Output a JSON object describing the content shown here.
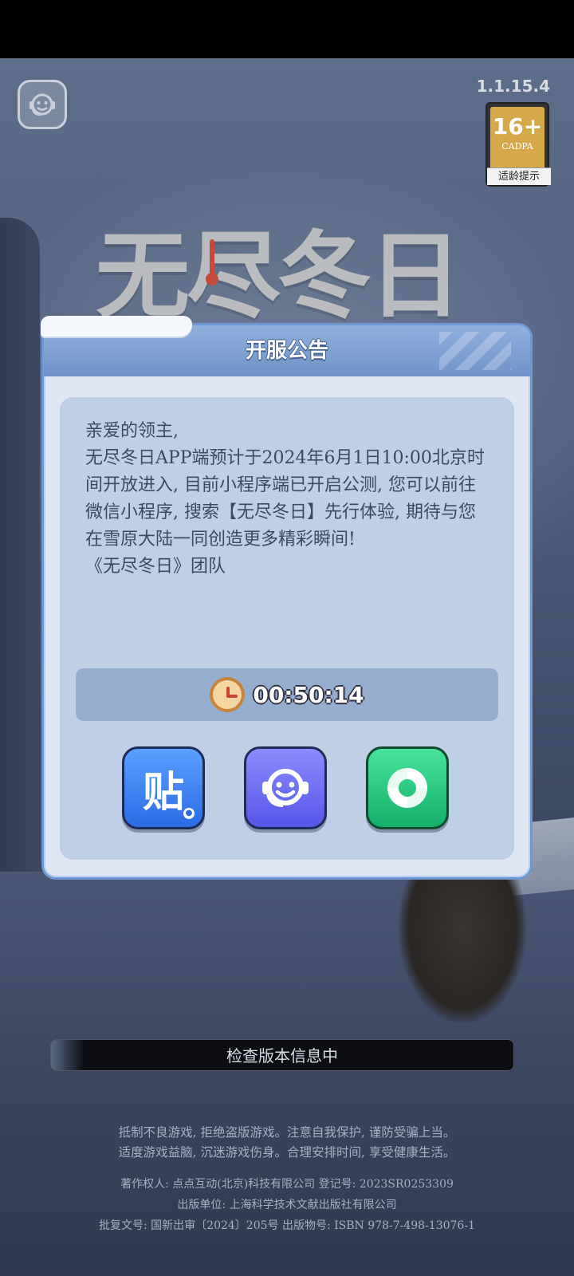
{
  "top": {
    "version": "1.1.15.4",
    "age_rating": {
      "number": "16+",
      "org": "CADPA",
      "tip": "适龄提示"
    }
  },
  "logo": {
    "text": "无尽冬日"
  },
  "dialog": {
    "title": "开服公告",
    "notice": {
      "greeting": "亲爱的领主,",
      "body": "无尽冬日APP端预计于2024年6月1日10:00北京时间开放进入, 目前小程序端已开启公测, 您可以前往微信小程序, 搜索【无尽冬日】先行体验, 期待与您在雪原大陆一同创造更多精彩瞬间!",
      "signature": "《无尽冬日》团队"
    },
    "countdown": "00:50:14",
    "actions": [
      {
        "label": "贴",
        "icon": "tieba-icon"
      },
      {
        "icon": "customer-service-icon"
      },
      {
        "icon": "share-icon"
      }
    ]
  },
  "progress": {
    "text": "检查版本信息中",
    "fraction": 0.07
  },
  "footer": {
    "health_line1": "抵制不良游戏, 拒绝盗版游戏。注意自我保护, 谨防受骗上当。",
    "health_line2": "适度游戏益脑, 沉迷游戏伤身。合理安排时间, 享受健康生活。",
    "copyright_line1": "著作权人: 点点互动(北京)科技有限公司  登记号: 2023SR0253309",
    "copyright_line2": "出版单位: 上海科学技术文献出版社有限公司",
    "copyright_line3": "批复文号: 国新出审〔2024〕205号  出版物号: ISBN 978-7-498-13076-1"
  },
  "colors": {
    "dialog_border": "#6d98d3",
    "panel": "#bfd0e6",
    "tieba": "#2c6be6",
    "service": "#5656e8",
    "share": "#13b06a"
  }
}
